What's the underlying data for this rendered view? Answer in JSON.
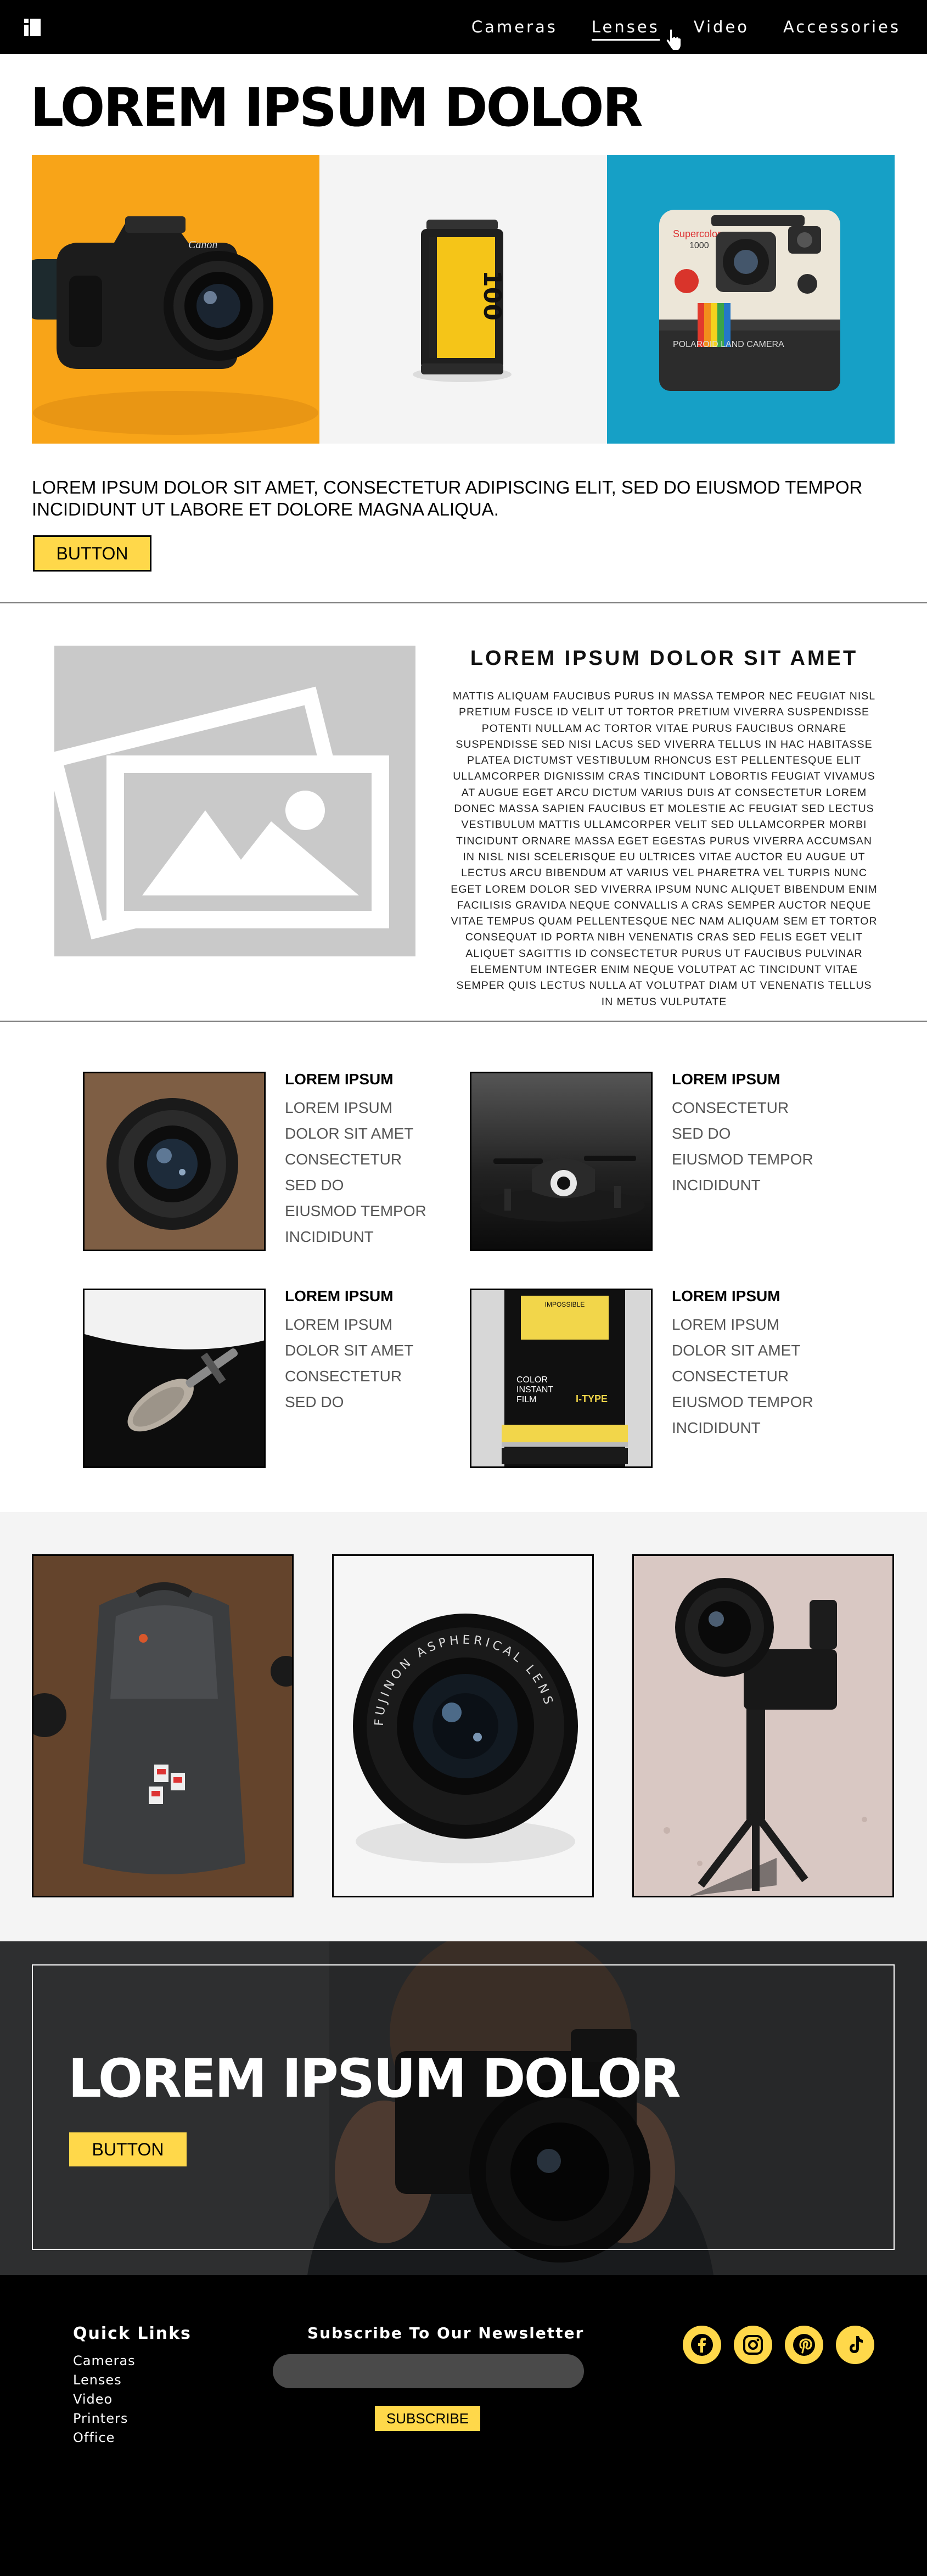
{
  "nav": {
    "links": [
      "Cameras",
      "Lenses",
      "Video",
      "Accessories"
    ],
    "active": "Lenses"
  },
  "hero": {
    "title": "LOREM IPSUM DOLOR",
    "text": "LOREM IPSUM DOLOR SIT AMET, CONSECTETUR ADIPISCING ELIT, SED DO EIUSMOD TEMPOR INCIDIDUNT UT LABORE ET DOLORE MAGNA ALIQUA.",
    "button": "BUTTON",
    "images": [
      "canon-camera-photo",
      "yellow-film-roll-photo",
      "polaroid-camera-photo"
    ],
    "film_label": "100",
    "polaroid_labels": {
      "brand": "Supercolor",
      "model": "1000",
      "plate": "POLAROID LAND CAMERA"
    },
    "canon_label": "Canon"
  },
  "feature": {
    "title": "LOREM IPSUM DOLOR SIT AMET",
    "body": "Mattis aliquam faucibus purus in massa tempor nec feugiat nisl pretium fusce id velit ut tortor pretium viverra suspendisse potenti nullam ac tortor vitae purus faucibus ornare suspendisse sed nisi lacus sed viverra tellus in hac habitasse platea dictumst vestibulum rhoncus est pellentesque elit ullamcorper dignissim cras tincidunt lobortis feugiat vivamus at augue eget arcu dictum varius duis at consectetur lorem donec massa sapien faucibus et molestie ac feugiat sed lectus vestibulum mattis ullamcorper velit sed ullamcorper morbi tincidunt ornare massa eget egestas purus viverra accumsan in nisl nisi scelerisque eu ultrices vitae auctor eu augue ut lectus arcu bibendum at varius vel pharetra vel turpis nunc eget lorem dolor sed viverra ipsum nunc aliquet bibendum enim facilisis gravida neque convallis a cras semper auctor neque vitae tempus quam pellentesque nec nam aliquam sem et tortor consequat id porta nibh venenatis cras sed felis eget velit aliquet sagittis id consectetur purus ut faucibus pulvinar elementum integer enim neque volutpat ac tincidunt vitae semper quis lectus nulla at volutpat diam ut venenatis tellus in metus vulputate",
    "image": "image-placeholder-icon"
  },
  "cards": [
    {
      "title": "LOREM IPSUM",
      "lines": [
        "LOREM IPSUM",
        "DOLOR SIT AMET",
        "CONSECTETUR",
        "SED DO",
        "EIUSMOD TEMPOR",
        "INCIDIDUNT"
      ],
      "image": "camera-lens-photo"
    },
    {
      "title": "LOREM IPSUM",
      "lines": [
        "CONSECTETUR",
        "SED DO",
        "EIUSMOD TEMPOR",
        "INCIDIDUNT"
      ],
      "image": "drone-photo"
    },
    {
      "title": "LOREM IPSUM",
      "lines": [
        "LOREM IPSUM",
        "DOLOR SIT AMET",
        "CONSECTETUR",
        "SED DO"
      ],
      "image": "microphone-photo"
    },
    {
      "title": "LOREM IPSUM",
      "lines": [
        "LOREM IPSUM",
        "DOLOR SIT AMET",
        "CONSECTETUR",
        "EIUSMOD TEMPOR",
        "INCIDIDUNT"
      ],
      "image": "instant-film-photo"
    }
  ],
  "film_box": {
    "brand": "IMPOSSIBLE",
    "line1": "COLOR",
    "line2": "INSTANT",
    "line3": "FILM",
    "type": "I-TYPE"
  },
  "gallery": [
    "backpack-photo",
    "fujinon-lens-photo",
    "gimbal-camera-photo"
  ],
  "lens_ring_text": "FUJINON ASPHERICAL LENS",
  "banner": {
    "title": "LOREM IPSUM DOLOR",
    "button": "BUTTON",
    "image": "photographer-with-camera-photo"
  },
  "footer": {
    "quick_links_title": "Quick Links",
    "quick_links": [
      "Cameras",
      "Lenses",
      "Video",
      "Printers",
      "Office"
    ],
    "newsletter_title": "Subscribe To Our Newsletter",
    "newsletter_placeholder": "",
    "subscribe": "SUBSCRIBE",
    "social": [
      "facebook-icon",
      "instagram-icon",
      "pinterest-icon",
      "tiktok-icon"
    ]
  },
  "colors": {
    "accent": "#ffd84a",
    "nav_bg": "#000000",
    "footer_bg": "#000000",
    "placeholder_grey": "#c9c9c9"
  }
}
